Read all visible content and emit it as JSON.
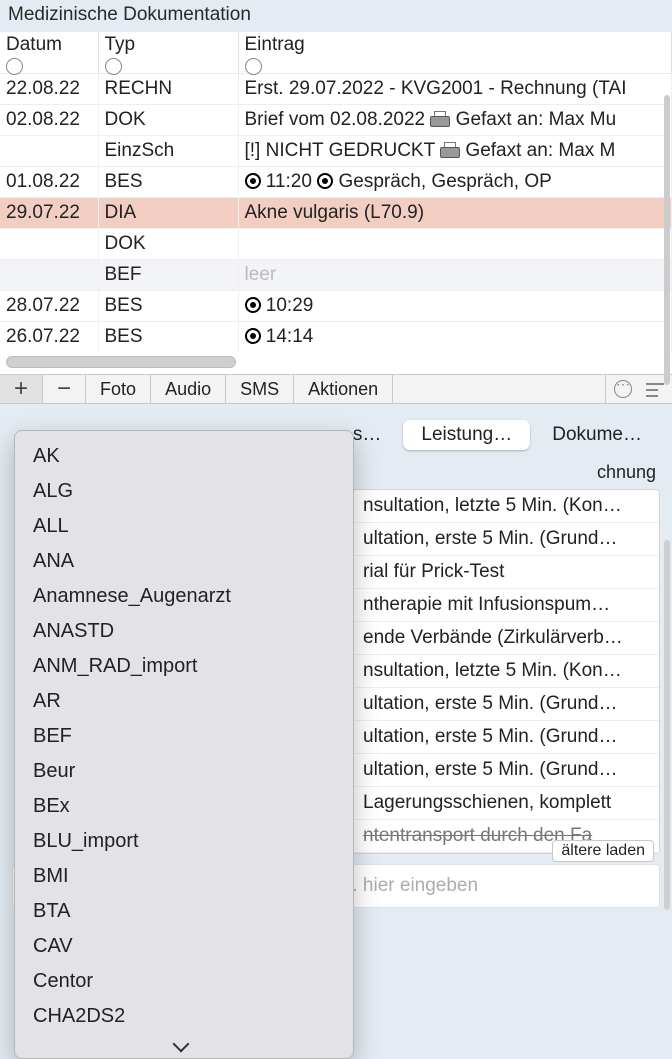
{
  "title": "Medizinische Dokumentation",
  "columns": {
    "date": "Datum",
    "type": "Typ",
    "entry": "Eintrag"
  },
  "rows": [
    {
      "date": "22.08.22",
      "type": "RECHN",
      "entry": "Erst. 29.07.2022 - KVG2001 - Rechnung (TAI",
      "printer": false
    },
    {
      "date": "02.08.22",
      "type": "DOK",
      "entry": "Brief vom 02.08.2022",
      "printer": true,
      "suffix": "Gefaxt an: Max Mu"
    },
    {
      "date": "",
      "type": "EinzSch",
      "entry": "[!] NICHT GEDRUCKT",
      "printer": true,
      "suffix": "Gefaxt an:  Max M"
    },
    {
      "date": "01.08.22",
      "type": "BES",
      "bullets": [
        "11:20",
        "Gespräch, Gespräch, OP"
      ]
    },
    {
      "date": "29.07.22",
      "type": "DIA",
      "entry": "Akne vulgaris (L70.9)",
      "highlight": true
    },
    {
      "date": "",
      "type": "DOK",
      "entry": ""
    },
    {
      "date": "",
      "type": "BEF",
      "entry": "leer",
      "muted": true,
      "alt": true
    },
    {
      "date": "28.07.22",
      "type": "BES",
      "bullets": [
        "10:29"
      ]
    },
    {
      "date": "26.07.22",
      "type": "BES",
      "bullets": [
        "14:14"
      ]
    }
  ],
  "toolbar": {
    "foto": "Foto",
    "audio": "Audio",
    "sms": "SMS",
    "aktionen": "Aktionen"
  },
  "dropdown_items": [
    "AK",
    "ALG",
    "ALL",
    "ANA",
    "Anamnese_Augenarzt",
    "ANASTD",
    "ANM_RAD_import",
    "AR",
    "BEF",
    "Beur",
    "BEx",
    "BLU_import",
    "BMI",
    "BTA",
    "CAV",
    "Centor",
    "CHA2DS2"
  ],
  "pills": {
    "left_trunc": "s…",
    "leistung": "Leistung…",
    "dokumente": "Dokume…"
  },
  "sub_col_header": "chnung",
  "services": [
    "nsultation, letzte 5 Min. (Kon…",
    "ultation, erste 5 Min. (Grund…",
    "rial für Prick-Test",
    "ntherapie mit Infusionspum…",
    "ende Verbände (Zirkulärverb…",
    "nsultation, letzte 5 Min. (Kon…",
    "ultation, erste 5 Min. (Grund…",
    "ultation, erste 5 Min. (Grund…",
    "ultation, erste 5 Min. (Grund…",
    "Lagerungsschienen, komplett"
  ],
  "services_tail_strike": "ntentransport durch den Fa",
  "older_chip": "ältere laden",
  "entry_hint": "tung, Diagnose etc. hier eingeben"
}
